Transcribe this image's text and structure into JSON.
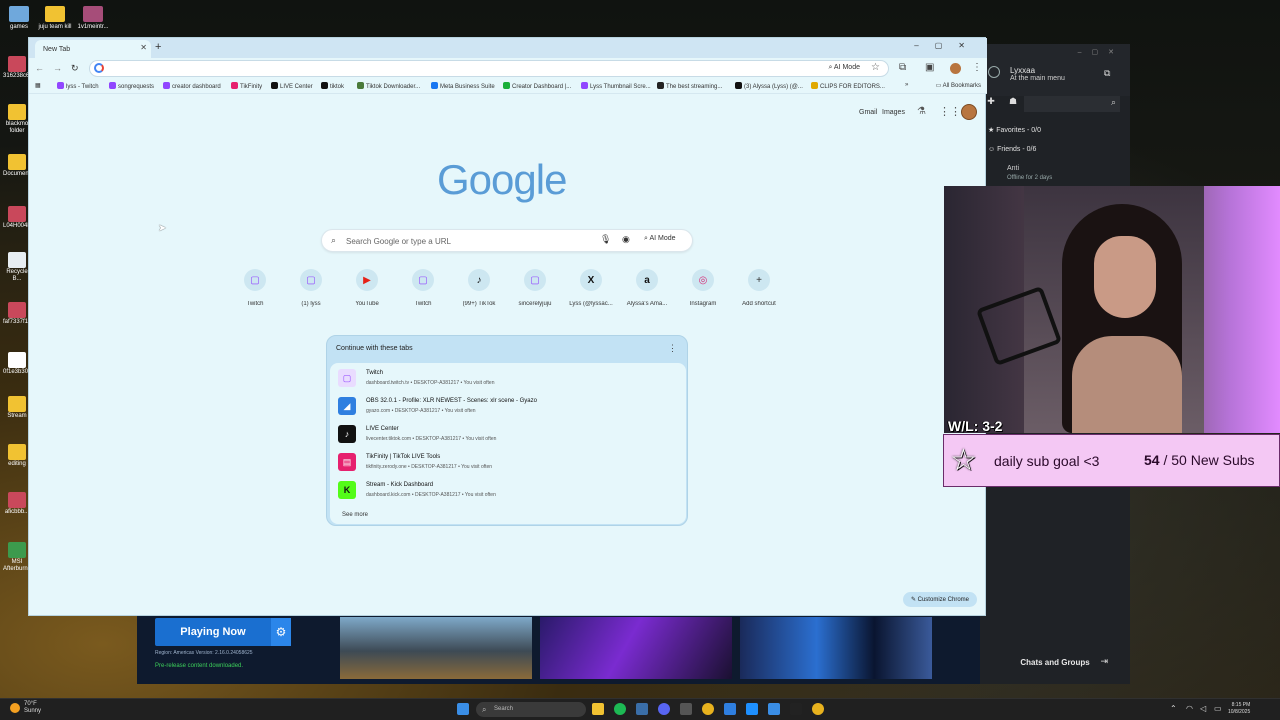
{
  "desktop": {
    "top_icons": [
      {
        "label": "games",
        "color": "#6fa8dc"
      },
      {
        "label": "juju team kill",
        "color": "#f1c232"
      },
      {
        "label": "1v1meintr...",
        "color": "#a64d79"
      }
    ],
    "side_icons": [
      {
        "label": "316238c6...",
        "color": "#c9485b"
      },
      {
        "label": "blackmo folder",
        "color": "#f1c232"
      },
      {
        "label": "Documen...",
        "color": "#f1c232"
      },
      {
        "label": "L04H004l...",
        "color": "#c9485b"
      },
      {
        "label": "Recycle B...",
        "color": "#ffffff"
      },
      {
        "label": "faf7337f1...",
        "color": "#c9485b"
      },
      {
        "label": "0f1e3b30...",
        "color": "#ffffff"
      },
      {
        "label": "Stream",
        "color": "#f1c232"
      },
      {
        "label": "editing",
        "color": "#f1c232"
      },
      {
        "label": "aficbbb...",
        "color": "#c9485b"
      },
      {
        "label": "MSI Afterburn...",
        "color": "#3c9a4d"
      }
    ]
  },
  "browser": {
    "tab_title": "New Tab",
    "toolbar": {
      "ai_mode": "AI Mode"
    },
    "bookmarks": [
      {
        "label": "lyss - Twitch",
        "color": "#9146ff"
      },
      {
        "label": "songrequests",
        "color": "#9146ff"
      },
      {
        "label": "creator dashboard",
        "color": "#9146ff"
      },
      {
        "label": "TikFinity",
        "color": "#e6206e"
      },
      {
        "label": "LIVE Center",
        "color": "#111111"
      },
      {
        "label": "tiktok",
        "color": "#111111"
      },
      {
        "label": "Tiktok Downloader...",
        "color": "#4a7a3a"
      },
      {
        "label": "Meta Business Suite",
        "color": "#1877f2"
      },
      {
        "label": "Creator Dashboard |...",
        "color": "#1aaf3a"
      },
      {
        "label": "Lyss Thumbnail Scre...",
        "color": "#9146ff"
      },
      {
        "label": "The best streaming...",
        "color": "#222222"
      },
      {
        "label": "(3) Alyssa (Lyss) (@...",
        "color": "#111111"
      },
      {
        "label": "CLIPS FOR EDITORS...",
        "color": "#e0a800"
      }
    ],
    "all_bookmarks": "All Bookmarks",
    "top_links": {
      "gmail": "Gmail",
      "images": "Images"
    },
    "logo": {
      "text": "Google"
    },
    "search": {
      "placeholder": "Search Google or type a URL",
      "ai_mode": "AI Mode"
    },
    "shortcuts": [
      {
        "label": "Twitch",
        "glyph": "▢",
        "color": "#9146ff"
      },
      {
        "label": "(1) lyss",
        "glyph": "▢",
        "color": "#9146ff"
      },
      {
        "label": "YouTube",
        "glyph": "▶",
        "color": "#e62117"
      },
      {
        "label": "Twitch",
        "glyph": "▢",
        "color": "#9146ff"
      },
      {
        "label": "(99+) TikTok",
        "glyph": "♪",
        "color": "#111111"
      },
      {
        "label": "sincerelyjuju",
        "glyph": "▢",
        "color": "#9146ff"
      },
      {
        "label": "Lyss (@lyssac...",
        "glyph": "X",
        "color": "#111111"
      },
      {
        "label": "Alyssa's Ama...",
        "glyph": "a",
        "color": "#111111"
      },
      {
        "label": "Instagram",
        "glyph": "◎",
        "color": "#d62976"
      },
      {
        "label": "Add shortcut",
        "glyph": "+",
        "color": "#333333"
      }
    ],
    "continue": {
      "header": "Continue with these tabs",
      "tabs": [
        {
          "title": "Twitch",
          "sub": "dashboard.twitch.tv • DESKTOP-A381217 • You visit often",
          "color": "#9146ff",
          "glyph": "▢"
        },
        {
          "title": "OBS 32.0.1 - Profile: XLR NEWEST - Scenes: xlr scene - Gyazo",
          "sub": "gyazo.com • DESKTOP-A381217 • You visit often",
          "color": "#2f7fe0",
          "glyph": "◢"
        },
        {
          "title": "LIVE Center",
          "sub": "livecenter.tiktok.com • DESKTOP-A381217 • You visit often",
          "color": "#111111",
          "glyph": "♪"
        },
        {
          "title": "TikFinity | TikTok LIVE Tools",
          "sub": "tikfinity.zerody.one • DESKTOP-A381217 • You visit often",
          "color": "#e6206e",
          "glyph": "▤"
        },
        {
          "title": "Stream - Kick Dashboard",
          "sub": "dashboard.kick.com • DESKTOP-A381217 • You visit often",
          "color": "#53fc18",
          "glyph": "K"
        }
      ],
      "see_more": "See more"
    },
    "customize": "Customize Chrome"
  },
  "launcher": {
    "play_label": "Playing Now",
    "region": "Region: Americas   Version: 2.16.0.24058625",
    "status": "Pre-release content downloaded."
  },
  "social_panel": {
    "username": "Lyxxaa",
    "status": "At the main menu",
    "favorites": "Favorites - 0/0",
    "friends": "Friends - 0/6",
    "friend_name": "Anti",
    "friend_status": "Offline for 2 days",
    "chats": "Chats and Groups"
  },
  "stream_overlay": {
    "record": "W/L: 3-2",
    "goal_label": "daily sub goal <3",
    "goal_current": "54",
    "goal_target": "/ 50 New Subs"
  },
  "taskbar": {
    "weather_temp": "70°F",
    "weather_desc": "Sunny",
    "search": "Search",
    "time": "8:15 PM",
    "date": "10/8/2025"
  }
}
